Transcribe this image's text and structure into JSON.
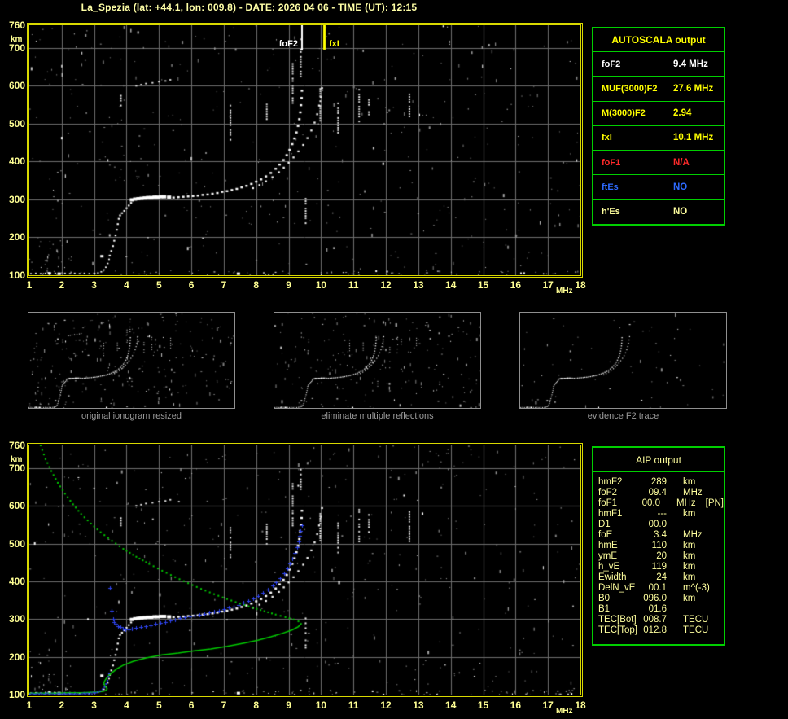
{
  "header": {
    "title": "La_Spezia (lat: +44.1, lon: 009.8) - DATE: 2026 04 06 - TIME (UT): 12:15"
  },
  "autoscala_table": {
    "title": "AUTOSCALA output",
    "rows": [
      {
        "label": "foF2",
        "value": "9.4 MHz",
        "color": "#ffffff"
      },
      {
        "label": "MUF(3000)F2",
        "value": "27.6 MHz",
        "color": "#ffff00"
      },
      {
        "label": "M(3000)F2",
        "value": "2.94",
        "color": "#ffff00"
      },
      {
        "label": "fxI",
        "value": "10.1 MHz",
        "color": "#ffff00"
      },
      {
        "label": "foF1",
        "value": "N/A",
        "color": "#ff2a2a"
      },
      {
        "label": "ftEs",
        "value": "NO",
        "color": "#2e6bff"
      },
      {
        "label": "h'Es",
        "value": "NO",
        "color": "#ffff9e"
      }
    ]
  },
  "aip_table": {
    "title": "AIP output",
    "rows": [
      {
        "label": "hmF2",
        "value": "289",
        "unit": "km",
        "note": ""
      },
      {
        "label": "foF2",
        "value": "09.4",
        "unit": "MHz",
        "note": ""
      },
      {
        "label": "foF1",
        "value": "00.0",
        "unit": "MHz",
        "note": "[PN]"
      },
      {
        "label": "hmF1",
        "value": "---",
        "unit": "km",
        "note": ""
      },
      {
        "label": "D1",
        "value": "00.0",
        "unit": "",
        "note": ""
      },
      {
        "label": "foE",
        "value": "3.4",
        "unit": "MHz",
        "note": ""
      },
      {
        "label": "hmE",
        "value": "110",
        "unit": "km",
        "note": ""
      },
      {
        "label": "ymE",
        "value": "20",
        "unit": "km",
        "note": ""
      },
      {
        "label": "h_vE",
        "value": "119",
        "unit": "km",
        "note": ""
      },
      {
        "label": "Ewidth",
        "value": "24",
        "unit": "km",
        "note": ""
      },
      {
        "label": "DelN_vE",
        "value": "00.1",
        "unit": "m^(-3)",
        "note": ""
      },
      {
        "label": "B0",
        "value": "096.0",
        "unit": "km",
        "note": ""
      },
      {
        "label": "B1",
        "value": "01.6",
        "unit": "",
        "note": ""
      },
      {
        "label": "TEC[Bot]",
        "value": "008.7",
        "unit": "TECU",
        "note": ""
      },
      {
        "label": "TEC[Top]",
        "value": "012.8",
        "unit": "TECU",
        "note": ""
      }
    ]
  },
  "thumbnails": [
    {
      "caption": "original ionogram resized",
      "noise": 265,
      "seed": 101,
      "mode": "full"
    },
    {
      "caption": "eliminate multiple reflections",
      "noise": 215,
      "seed": 202,
      "mode": "clean1"
    },
    {
      "caption": "evidence F2 trace",
      "noise": 62,
      "seed": 303,
      "mode": "clean2"
    }
  ],
  "chart_data": {
    "type": "scatter",
    "title": "ionogram",
    "x_range": [
      1,
      18
    ],
    "y_range": [
      100,
      760
    ],
    "x_ticks": [
      1,
      2,
      3,
      4,
      5,
      6,
      7,
      8,
      9,
      10,
      11,
      12,
      13,
      14,
      15,
      16,
      17,
      18
    ],
    "y_ticks": [
      760,
      700,
      600,
      500,
      400,
      300,
      200,
      100
    ],
    "x_unit": "MHz",
    "y_unit": "km",
    "markers": {
      "foF2": {
        "label": "foF2",
        "freq": 9.4,
        "color": "#ffffff"
      },
      "fxI": {
        "label": "fxI",
        "freq": 10.1,
        "color": "#ffff00"
      }
    },
    "o_trace": [
      [
        4.15,
        299
      ],
      [
        4.25,
        301
      ],
      [
        4.35,
        302
      ],
      [
        4.45,
        303
      ],
      [
        4.55,
        304
      ],
      [
        4.65,
        305
      ],
      [
        4.75,
        305
      ],
      [
        4.85,
        306
      ],
      [
        4.95,
        306
      ],
      [
        5.05,
        307
      ],
      [
        5.15,
        307
      ],
      [
        5.3,
        306
      ],
      [
        5.45,
        305
      ],
      [
        5.6,
        306
      ],
      [
        5.75,
        307
      ],
      [
        5.9,
        308
      ],
      [
        6.05,
        309
      ],
      [
        6.2,
        310
      ],
      [
        6.35,
        312
      ],
      [
        6.5,
        313
      ],
      [
        6.65,
        315
      ],
      [
        6.8,
        317
      ],
      [
        6.95,
        320
      ],
      [
        7.1,
        322
      ],
      [
        7.25,
        325
      ],
      [
        7.4,
        328
      ],
      [
        7.55,
        332
      ],
      [
        7.7,
        336
      ],
      [
        7.85,
        341
      ],
      [
        8.0,
        347
      ],
      [
        8.15,
        353
      ],
      [
        8.3,
        361
      ],
      [
        8.45,
        370
      ],
      [
        8.6,
        381
      ],
      [
        8.72,
        392
      ],
      [
        8.84,
        404
      ],
      [
        8.94,
        417
      ],
      [
        9.03,
        431
      ],
      [
        9.11,
        446
      ],
      [
        9.18,
        461
      ],
      [
        9.24,
        477
      ],
      [
        9.29,
        494
      ],
      [
        9.33,
        512
      ],
      [
        9.36,
        530
      ],
      [
        9.38,
        549
      ],
      [
        9.4,
        568
      ],
      [
        9.41,
        587
      ]
    ],
    "x_trace": [
      [
        7.9,
        330
      ],
      [
        8.1,
        338
      ],
      [
        8.3,
        348
      ],
      [
        8.5,
        359
      ],
      [
        8.7,
        372
      ],
      [
        8.85,
        384
      ],
      [
        9.0,
        397
      ],
      [
        9.15,
        411
      ],
      [
        9.3,
        427
      ],
      [
        9.45,
        444
      ],
      [
        9.58,
        462
      ],
      [
        9.7,
        482
      ],
      [
        9.8,
        503
      ],
      [
        9.88,
        525
      ],
      [
        9.94,
        548
      ],
      [
        9.99,
        571
      ],
      [
        10.03,
        594
      ]
    ],
    "lead_in": [
      [
        3.48,
        152
      ],
      [
        3.53,
        164
      ],
      [
        3.58,
        177
      ],
      [
        3.62,
        191
      ],
      [
        3.66,
        205
      ],
      [
        3.7,
        220
      ],
      [
        3.73,
        235
      ],
      [
        3.76,
        249
      ],
      [
        3.8,
        258
      ],
      [
        3.86,
        264
      ],
      [
        3.93,
        270
      ],
      [
        4.0,
        277
      ],
      [
        4.07,
        284
      ],
      [
        4.14,
        291
      ]
    ],
    "e_trace": [
      [
        1.05,
        104
      ],
      [
        1.2,
        105
      ],
      [
        1.35,
        104
      ],
      [
        1.5,
        105
      ],
      [
        1.65,
        104
      ],
      [
        1.8,
        105
      ],
      [
        1.95,
        104
      ],
      [
        2.1,
        105
      ],
      [
        2.25,
        104
      ],
      [
        2.4,
        105
      ],
      [
        2.55,
        104
      ],
      [
        2.7,
        105
      ],
      [
        2.85,
        104
      ],
      [
        3.0,
        105
      ],
      [
        3.12,
        106
      ],
      [
        3.22,
        109
      ],
      [
        3.3,
        114
      ],
      [
        3.36,
        121
      ],
      [
        3.42,
        131
      ],
      [
        3.46,
        142
      ]
    ],
    "second_hop": [
      [
        4.3,
        600
      ],
      [
        4.45,
        603
      ],
      [
        4.6,
        606
      ],
      [
        4.8,
        608
      ],
      [
        5.0,
        611
      ],
      [
        5.2,
        613
      ],
      [
        5.35,
        616
      ]
    ],
    "hotspots": [
      [
        1.62,
        105
      ],
      [
        1.92,
        104
      ],
      [
        3.24,
        150
      ],
      [
        7.45,
        104
      ],
      [
        4.4,
        303
      ],
      [
        4.9,
        306
      ]
    ],
    "streaks": [
      [
        3.8,
        546,
        576
      ],
      [
        7.18,
        455,
        550
      ],
      [
        8.3,
        497,
        553
      ],
      [
        9.1,
        548,
        660
      ],
      [
        9.35,
        622,
        698
      ],
      [
        9.5,
        222,
        304
      ],
      [
        9.95,
        506,
        594
      ],
      [
        10.5,
        478,
        556
      ],
      [
        11.15,
        504,
        592
      ],
      [
        11.45,
        526,
        578
      ],
      [
        12.7,
        508,
        586
      ]
    ],
    "profile_topside": [
      [
        1.35,
        760
      ],
      [
        1.5,
        724
      ],
      [
        1.68,
        692
      ],
      [
        1.88,
        661
      ],
      [
        2.1,
        632
      ],
      [
        2.35,
        604
      ],
      [
        2.6,
        578
      ],
      [
        2.9,
        553
      ],
      [
        3.2,
        530
      ],
      [
        3.55,
        507
      ],
      [
        3.9,
        486
      ],
      [
        4.3,
        465
      ],
      [
        4.7,
        446
      ],
      [
        5.1,
        428
      ],
      [
        5.5,
        411
      ],
      [
        5.9,
        395
      ],
      [
        6.3,
        380
      ],
      [
        6.7,
        366
      ],
      [
        7.1,
        353
      ],
      [
        7.5,
        341
      ],
      [
        7.9,
        330
      ],
      [
        8.25,
        321
      ],
      [
        8.6,
        312
      ],
      [
        8.9,
        305
      ],
      [
        9.15,
        299
      ],
      [
        9.3,
        294
      ],
      [
        9.4,
        289
      ]
    ],
    "profile_bottomside": [
      [
        9.4,
        289
      ],
      [
        9.3,
        280
      ],
      [
        9.1,
        271
      ],
      [
        8.8,
        262
      ],
      [
        8.45,
        253
      ],
      [
        8.05,
        244
      ],
      [
        7.6,
        236
      ],
      [
        7.1,
        228
      ],
      [
        6.6,
        221
      ],
      [
        6.1,
        216
      ],
      [
        5.6,
        210
      ],
      [
        5.1,
        205
      ],
      [
        4.6,
        197
      ],
      [
        4.2,
        188
      ],
      [
        3.9,
        178
      ],
      [
        3.7,
        168
      ],
      [
        3.55,
        158
      ],
      [
        3.45,
        150
      ],
      [
        3.38,
        143
      ],
      [
        3.33,
        137
      ],
      [
        3.3,
        131
      ],
      [
        3.32,
        125
      ],
      [
        3.36,
        120
      ],
      [
        3.4,
        116
      ],
      [
        3.38,
        112
      ],
      [
        3.3,
        109
      ],
      [
        3.15,
        107
      ],
      [
        2.9,
        106
      ],
      [
        2.6,
        105
      ],
      [
        2.2,
        105
      ],
      [
        1.8,
        104
      ],
      [
        1.4,
        104
      ],
      [
        1.0,
        104
      ]
    ],
    "restored_trace": {
      "e_start": 1.0,
      "e_end": 3.05,
      "e_alt": 104,
      "cusp": [
        [
          3.1,
          106
        ],
        [
          3.18,
          109
        ],
        [
          3.26,
          114
        ],
        [
          3.32,
          120
        ],
        [
          3.37,
          128
        ],
        [
          3.41,
          137
        ],
        [
          3.44,
          147
        ],
        [
          3.46,
          156
        ]
      ],
      "isolated": [
        [
          3.49,
          383
        ],
        [
          3.54,
          322
        ]
      ],
      "f_trace": [
        [
          3.58,
          300
        ],
        [
          3.62,
          293
        ],
        [
          3.67,
          287
        ],
        [
          3.73,
          282
        ],
        [
          3.8,
          278
        ],
        [
          3.88,
          275
        ],
        [
          3.97,
          273
        ],
        [
          4.07,
          273
        ],
        [
          4.17,
          274
        ],
        [
          4.3,
          276
        ],
        [
          4.45,
          278
        ],
        [
          4.6,
          281
        ],
        [
          4.75,
          284
        ],
        [
          4.9,
          287
        ],
        [
          5.05,
          290
        ],
        [
          5.2,
          293
        ],
        [
          5.35,
          296
        ],
        [
          5.5,
          299
        ],
        [
          5.65,
          302
        ],
        [
          5.8,
          304
        ],
        [
          5.95,
          307
        ],
        [
          6.1,
          309
        ],
        [
          6.25,
          312
        ],
        [
          6.4,
          314
        ],
        [
          6.55,
          317
        ],
        [
          6.7,
          320
        ],
        [
          6.85,
          323
        ],
        [
          7.0,
          326
        ],
        [
          7.15,
          330
        ],
        [
          7.3,
          334
        ],
        [
          7.45,
          338
        ],
        [
          7.6,
          343
        ],
        [
          7.75,
          348
        ],
        [
          7.9,
          354
        ],
        [
          8.05,
          361
        ],
        [
          8.2,
          369
        ],
        [
          8.35,
          378
        ],
        [
          8.5,
          388
        ],
        [
          8.62,
          398
        ],
        [
          8.74,
          409
        ],
        [
          8.85,
          421
        ],
        [
          8.95,
          434
        ],
        [
          9.04,
          447
        ],
        [
          9.12,
          461
        ],
        [
          9.19,
          475
        ],
        [
          9.25,
          490
        ],
        [
          9.3,
          505
        ],
        [
          9.34,
          520
        ],
        [
          9.37,
          534
        ],
        [
          9.4,
          548
        ]
      ]
    },
    "colors": {
      "grid": "#6f6f6f",
      "border": "#d9d900",
      "ticks": "#ffff94",
      "profile": "#00cc00",
      "restored": "#2e44f0",
      "echo": "#ffffff"
    },
    "render": {
      "main_noise": 430,
      "main_seeds": [
        7,
        13
      ]
    }
  }
}
